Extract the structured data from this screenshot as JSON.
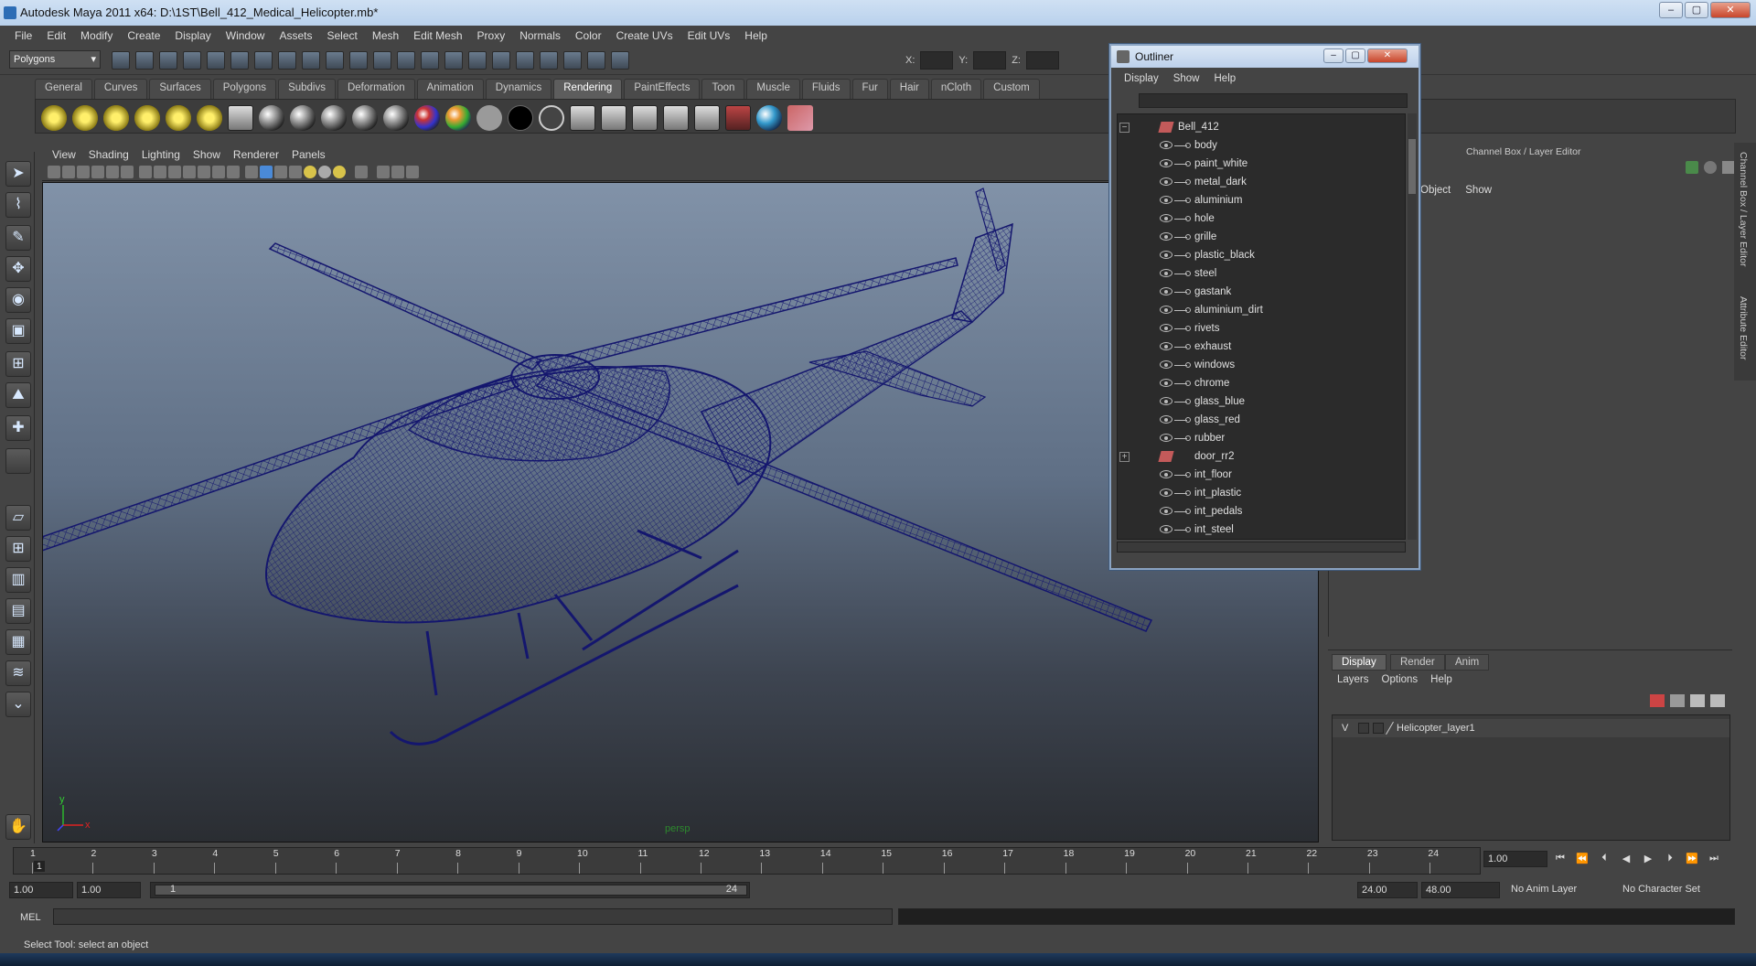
{
  "window": {
    "title": "Autodesk Maya 2011 x64: D:\\1ST\\Bell_412_Medical_Helicopter.mb*"
  },
  "menubar": [
    "File",
    "Edit",
    "Modify",
    "Create",
    "Display",
    "Window",
    "Assets",
    "Select",
    "Mesh",
    "Edit Mesh",
    "Proxy",
    "Normals",
    "Color",
    "Create UVs",
    "Edit UVs",
    "Help"
  ],
  "statusline": {
    "mode": "Polygons",
    "x_label": "X:",
    "y_label": "Y:",
    "z_label": "Z:"
  },
  "shelf_tabs": [
    "General",
    "Curves",
    "Surfaces",
    "Polygons",
    "Subdivs",
    "Deformation",
    "Animation",
    "Dynamics",
    "Rendering",
    "PaintEffects",
    "Toon",
    "Muscle",
    "Fluids",
    "Fur",
    "Hair",
    "nCloth",
    "Custom"
  ],
  "shelf_active": "Rendering",
  "viewport": {
    "menu": [
      "View",
      "Shading",
      "Lighting",
      "Show",
      "Renderer",
      "Panels"
    ],
    "camera": "persp",
    "axis_y": "y",
    "axis_x": "x"
  },
  "outliner": {
    "title": "Outliner",
    "menu": [
      "Display",
      "Show",
      "Help"
    ],
    "items": [
      {
        "label": "Bell_412",
        "kind": "transform",
        "expander": "−",
        "indent": 0
      },
      {
        "label": "body",
        "kind": "shader"
      },
      {
        "label": "paint_white",
        "kind": "shader"
      },
      {
        "label": "metal_dark",
        "kind": "shader"
      },
      {
        "label": "aluminium",
        "kind": "shader"
      },
      {
        "label": "hole",
        "kind": "shader"
      },
      {
        "label": "grille",
        "kind": "shader"
      },
      {
        "label": "plastic_black",
        "kind": "shader"
      },
      {
        "label": "steel",
        "kind": "shader"
      },
      {
        "label": "gastank",
        "kind": "shader"
      },
      {
        "label": "aluminium_dirt",
        "kind": "shader"
      },
      {
        "label": "rivets",
        "kind": "shader"
      },
      {
        "label": "exhaust",
        "kind": "shader"
      },
      {
        "label": "windows",
        "kind": "shader"
      },
      {
        "label": "chrome",
        "kind": "shader"
      },
      {
        "label": "glass_blue",
        "kind": "shader"
      },
      {
        "label": "glass_red",
        "kind": "shader"
      },
      {
        "label": "rubber",
        "kind": "shader"
      },
      {
        "label": "door_rr2",
        "kind": "transform",
        "expander": "+"
      },
      {
        "label": "int_floor",
        "kind": "shader"
      },
      {
        "label": "int_plastic",
        "kind": "shader"
      },
      {
        "label": "int_pedals",
        "kind": "shader"
      },
      {
        "label": "int_steel",
        "kind": "shader"
      }
    ]
  },
  "channelbox": {
    "title": "Channel Box / Layer Editor",
    "menu": [
      "Object",
      "Show"
    ]
  },
  "side_tabs": [
    "Channel Box / Layer Editor",
    "Attribute Editor"
  ],
  "layer_editor": {
    "tabs": [
      "Display",
      "Render",
      "Anim"
    ],
    "active_tab": "Display",
    "menu": [
      "Layers",
      "Options",
      "Help"
    ],
    "layers": [
      {
        "visible": "V",
        "name": "Helicopter_layer1"
      }
    ]
  },
  "timeline": {
    "ticks": [
      "1",
      "2",
      "3",
      "4",
      "5",
      "6",
      "7",
      "8",
      "9",
      "10",
      "11",
      "12",
      "13",
      "14",
      "15",
      "16",
      "17",
      "18",
      "19",
      "20",
      "21",
      "22",
      "23",
      "24"
    ],
    "current_marker": "1",
    "current_frame": "1.00"
  },
  "range": {
    "start_outer": "1.00",
    "start_inner": "1.00",
    "slider_start": "1",
    "slider_end": "24",
    "end_inner": "24.00",
    "end_outer": "48.00",
    "anim_layer": "No Anim Layer",
    "char_set": "No Character Set"
  },
  "cmdline": {
    "label": "MEL"
  },
  "helpline": {
    "text": "Select Tool: select an object"
  },
  "colors": {
    "wire": "#14166e",
    "ui_bg": "#444444",
    "outliner_bg": "#2b2b2b"
  }
}
